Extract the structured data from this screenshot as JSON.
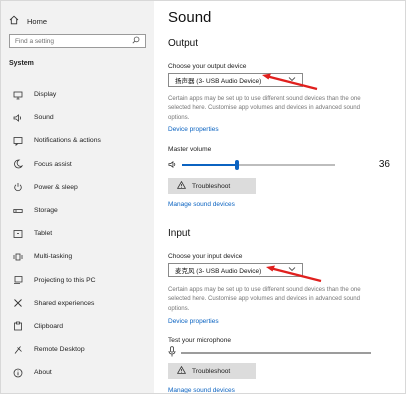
{
  "sidebar": {
    "home_label": "Home",
    "search_placeholder": "Find a setting",
    "section_label": "System",
    "items": [
      {
        "label": "Display",
        "icon": "monitor-icon"
      },
      {
        "label": "Sound",
        "icon": "speaker-icon"
      },
      {
        "label": "Notifications & actions",
        "icon": "notification-icon"
      },
      {
        "label": "Focus assist",
        "icon": "moon-icon"
      },
      {
        "label": "Power & sleep",
        "icon": "power-icon"
      },
      {
        "label": "Storage",
        "icon": "storage-icon"
      },
      {
        "label": "Tablet",
        "icon": "tablet-icon"
      },
      {
        "label": "Multi-tasking",
        "icon": "multitasking-icon"
      },
      {
        "label": "Projecting to this PC",
        "icon": "projecting-icon"
      },
      {
        "label": "Shared experiences",
        "icon": "shared-icon"
      },
      {
        "label": "Clipboard",
        "icon": "clipboard-icon"
      },
      {
        "label": "Remote Desktop",
        "icon": "remote-desktop-icon"
      },
      {
        "label": "About",
        "icon": "info-icon"
      }
    ]
  },
  "main": {
    "title": "Sound",
    "output": {
      "heading": "Output",
      "choose_label": "Choose your output device",
      "device": "扬声器 (3- USB Audio Device)",
      "description": "Certain apps may be set up to use different sound devices than the one selected here. Customise app volumes and devices in advanced sound options.",
      "properties_link": "Device properties",
      "master_volume_label": "Master volume",
      "volume": 36,
      "troubleshoot_label": "Troubleshoot",
      "manage_link": "Manage sound devices"
    },
    "input": {
      "heading": "Input",
      "choose_label": "Choose your input device",
      "device": "麦克风 (3- USB Audio Device)",
      "description": "Certain apps may be set up to use different sound devices than the one selected here. Customise app volumes and devices in advanced sound options.",
      "properties_link": "Device properties",
      "test_label": "Test your microphone",
      "troubleshoot_label": "Troubleshoot",
      "manage_link": "Manage sound devices"
    }
  },
  "colors": {
    "accent": "#0b63c1",
    "annotation": "#e0201e",
    "sidebar_bg": "#f2f2f2"
  }
}
